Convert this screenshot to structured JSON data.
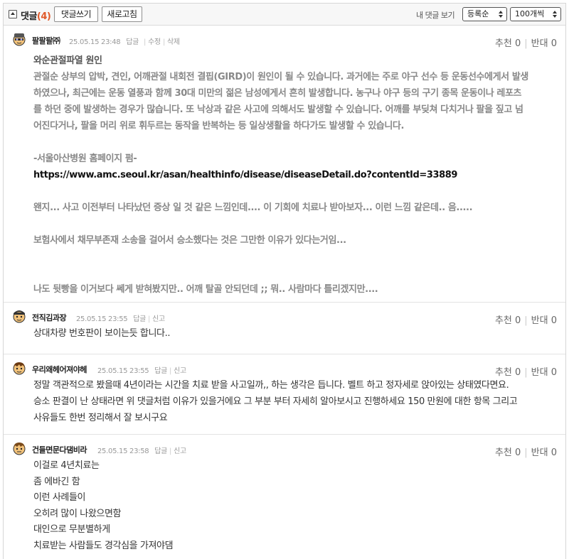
{
  "toolbar": {
    "title": "댓글",
    "count": "(4)",
    "write_label": "댓글쓰기",
    "refresh_label": "새로고침",
    "my_comments_label": "내 댓글 보기",
    "order_value": "등록순",
    "per_page_value": "100개씩"
  },
  "comments": [
    {
      "nick": "팔팔팔㈜",
      "date": "25.05.15 23:48",
      "actions": [
        "답글",
        "수정",
        "삭제"
      ],
      "recommend": "추천 0",
      "oppose": "반대 0",
      "lines": [
        "와순관절파열 원인",
        "관절순 상부의 압박, 견인, 어깨관절 내회전 결핍(GIRD)이 원인이 될 수 있습니다. 과거에는 주로 야구 선수 등 운동선수에게서 발생",
        "하였으나, 최근에는 운동 열풍과 함께 30대 미만의 젊은 남성에게서 흔히 발생합니다. 농구나 야구 등의 구기 종목 운동이나 레포츠",
        "를 하던 중에 발생하는 경우가 많습니다. 또 낙상과 같은 사고에 의해서도 발생할 수 있습니다. 어깨를 부딪쳐 다치거나 팔을 짚고 넘",
        "어진다거나, 팔을 머리 위로 휘두르는 동작을 반복하는 등 일상생활을 하다가도 발생할 수 있습니다.",
        "",
        "-서울아산병원 홈페이지 펌-",
        "https://www.amc.seoul.kr/asan/healthinfo/disease/diseaseDetail.do?contentId=33889",
        "",
        "왠지... 사고 이전부터 나타났던 증상 일 것 같은 느낌인데.... 이 기회에 치료나 받아보자... 이런 느낌 같은데.. 음.....",
        "",
        "보험사에서 채무부존재 소송을 걸어서 승소했다는 것은 그만한 이유가 있다는거임...",
        "",
        "",
        "나도 뒷빵을 이거보다 쎄게 받혀봤지만.. 어깨 탈골 안되던데 ;; 뭐.. 사람마다 틀리겠지만...."
      ]
    },
    {
      "nick": "전직김과장",
      "date": "25.05.15 23:55",
      "actions": [
        "답글",
        "신고"
      ],
      "recommend": "추천 0",
      "oppose": "반대 0",
      "lines": [
        "상대차량 번호판이 보이는듯 합니다.."
      ]
    },
    {
      "nick": "우리왜헤어져야헤",
      "date": "25.05.15 23:55",
      "actions": [
        "답글",
        "신고"
      ],
      "recommend": "추천 0",
      "oppose": "반대 0",
      "lines": [
        "정말 객관적으로 봤을때 4년이라는 시간을 치료 받을 사고일까,, 하는 생각은 듭니다. 벨트 하고 정자세로 앉아있는 상태였다면요.",
        "승소 판결이 난 상태라면 위 댓글처럼 이유가 있을거에요 그 부분 부터 자세히 알아보시고 진행하세요 150 만원에 대한 항목 그리고",
        "사유들도 한번 정리해서 잘 보시구요"
      ]
    },
    {
      "nick": "건들면문다댐비라",
      "date": "25.05.15 23:58",
      "actions": [
        "답글",
        "신고"
      ],
      "recommend": "추천 0",
      "oppose": "반대 0",
      "lines": [
        "이걸로 4년치료는",
        "좀 에바긴 함",
        "이런 사례들이",
        "오히려 많이 나왔으면함",
        "대인으로 무분별하게",
        "치료받는 사람들도 경각심을 가져야댐"
      ]
    }
  ]
}
